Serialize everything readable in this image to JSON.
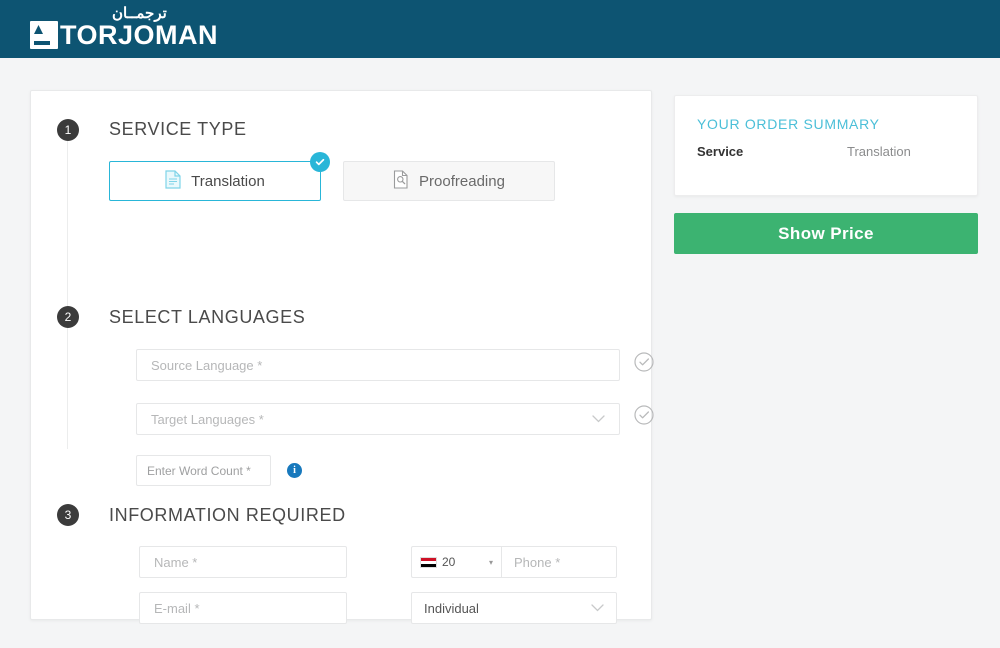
{
  "header": {
    "logo_arabic": "ترجمــان",
    "logo_word": "TORJOMAN",
    "logo_icon": "torjoman-mark-icon",
    "background_color": "#0d5472"
  },
  "form": {
    "steps": [
      {
        "number": "1",
        "title": "SERVICE TYPE"
      },
      {
        "number": "2",
        "title": "SELECT LANGUAGES"
      },
      {
        "number": "3",
        "title": "INFORMATION REQUIRED"
      }
    ],
    "service_type": {
      "options": [
        {
          "label": "Translation",
          "icon": "document-icon",
          "selected": true
        },
        {
          "label": "Proofreading",
          "icon": "document-magnifier-icon",
          "selected": false
        }
      ],
      "selected_badge_icon": "check-badge-icon",
      "selected_color": "#29b6d8"
    },
    "languages": {
      "source_placeholder": "Source Language *",
      "target_placeholder": "Target Languages *",
      "word_count_placeholder": "Enter Word Count *",
      "info_icon": "info-icon",
      "validation_icon": "circle-check-icon"
    },
    "information": {
      "name_placeholder": "Name *",
      "email_placeholder": "E-mail *",
      "phone_placeholder": "Phone *",
      "country_code": "20",
      "country_flag": "egypt-flag-icon",
      "customer_type": "Individual"
    }
  },
  "summary": {
    "title": "YOUR ORDER SUMMARY",
    "title_color": "#4bbfd8",
    "rows": [
      {
        "key": "Service",
        "value": "Translation"
      }
    ],
    "price_button_label": "Show Price",
    "price_button_color": "#3cb371"
  }
}
